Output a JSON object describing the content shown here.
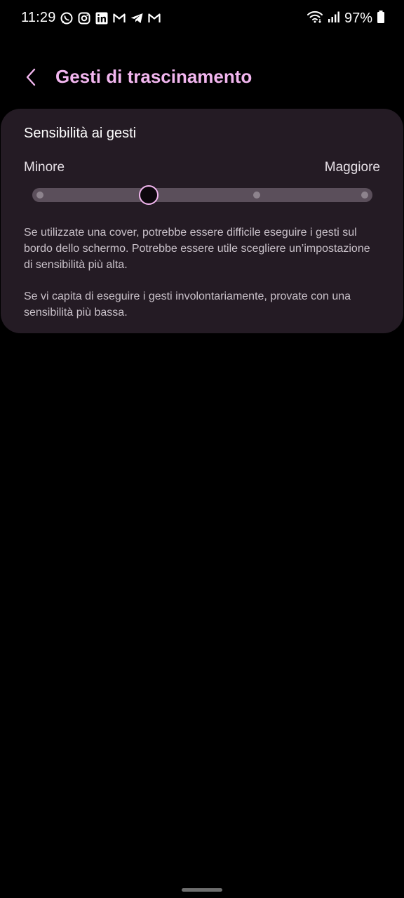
{
  "status_bar": {
    "time": "11:29",
    "battery": "97%",
    "notification_icons": [
      "whatsapp-icon",
      "instagram-icon",
      "linkedin-icon",
      "gmail-icon",
      "telegram-icon",
      "gmail-icon"
    ],
    "right_icons": [
      "wifi-icon",
      "signal-icon",
      "battery-icon"
    ]
  },
  "header": {
    "title": "Gesti di trascinamento",
    "back_icon": "chevron-left-icon"
  },
  "card": {
    "title": "Sensibilità ai gesti",
    "slider": {
      "min_label": "Minore",
      "max_label": "Maggiore",
      "steps": 4,
      "selected_index": 1
    },
    "description_1": "Se utilizzate una cover, potrebbe essere difficile eseguire i gesti sul bordo dello schermo. Potrebbe essere utile scegliere un’impostazione di sensibilità più alta.",
    "description_2": "Se vi capita di eseguire i gesti involontariamente, provate con una sensibilità più bassa."
  },
  "colors": {
    "accent": "#f2b6ef",
    "card_bg": "#241b24",
    "track": "#5b4f5b",
    "background": "#000000"
  }
}
